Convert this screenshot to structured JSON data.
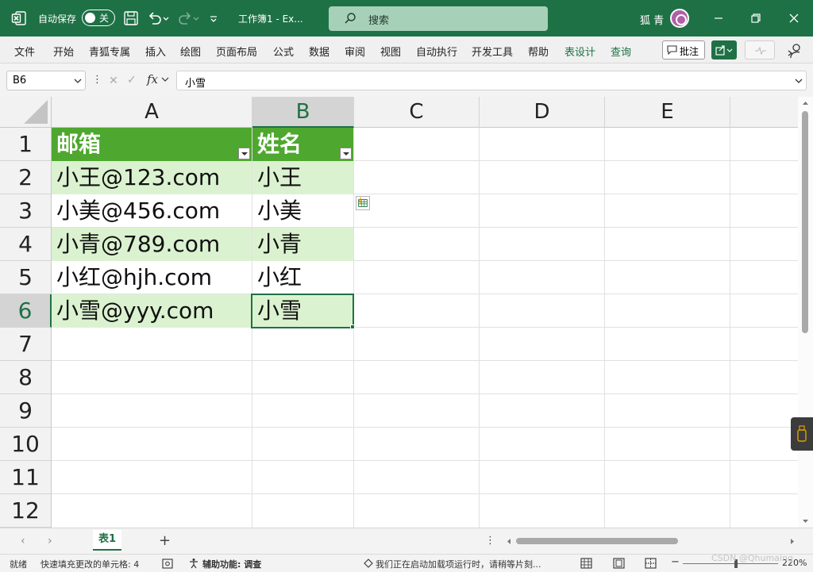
{
  "titlebar": {
    "autosave_label": "自动保存",
    "toggle_state": "关",
    "title": "工作簿1  -  Ex...",
    "search_placeholder": "搜索",
    "user_name": "狐 青",
    "accent_color": "#1e7145"
  },
  "ribbon": {
    "tabs": [
      "文件",
      "开始",
      "青狐专属",
      "插入",
      "绘图",
      "页面布局",
      "公式",
      "数据",
      "审阅",
      "视图",
      "自动执行",
      "开发工具",
      "帮助",
      "表设计",
      "查询"
    ],
    "highlighted_tabs": [
      "表设计",
      "查询"
    ],
    "comment_button": "批注"
  },
  "formula_bar": {
    "name_box": "B6",
    "fx_label": "fx",
    "content": "小雪"
  },
  "grid": {
    "columns": [
      "A",
      "B",
      "C",
      "D",
      "E"
    ],
    "selected_column": "B",
    "rows": [
      "1",
      "2",
      "3",
      "4",
      "5",
      "6",
      "7",
      "8",
      "9",
      "10",
      "11",
      "12"
    ],
    "selected_row": "6",
    "table_header": [
      "邮箱",
      "姓名"
    ],
    "table_rows": [
      [
        "小王@123.com",
        "小王"
      ],
      [
        "小美@456.com",
        "小美"
      ],
      [
        "小青@789.com",
        "小青"
      ],
      [
        "小红@hjh.com",
        "小红"
      ],
      [
        "小雪@yyy.com",
        "小雪"
      ]
    ],
    "header_color": "#4ea72e",
    "band_color": "#dbf2d0"
  },
  "sheets": {
    "tabs": [
      "表1"
    ],
    "active": "表1"
  },
  "statusbar": {
    "ready": "就绪",
    "fill_info": "快速填充更改的单元格: 4",
    "accessibility": "辅助功能: 调查",
    "addin_msg": "我们正在启动加载项运行时，请稍等片刻...",
    "zoom": "220%"
  },
  "watermark": "CSDN @Qhumaing"
}
